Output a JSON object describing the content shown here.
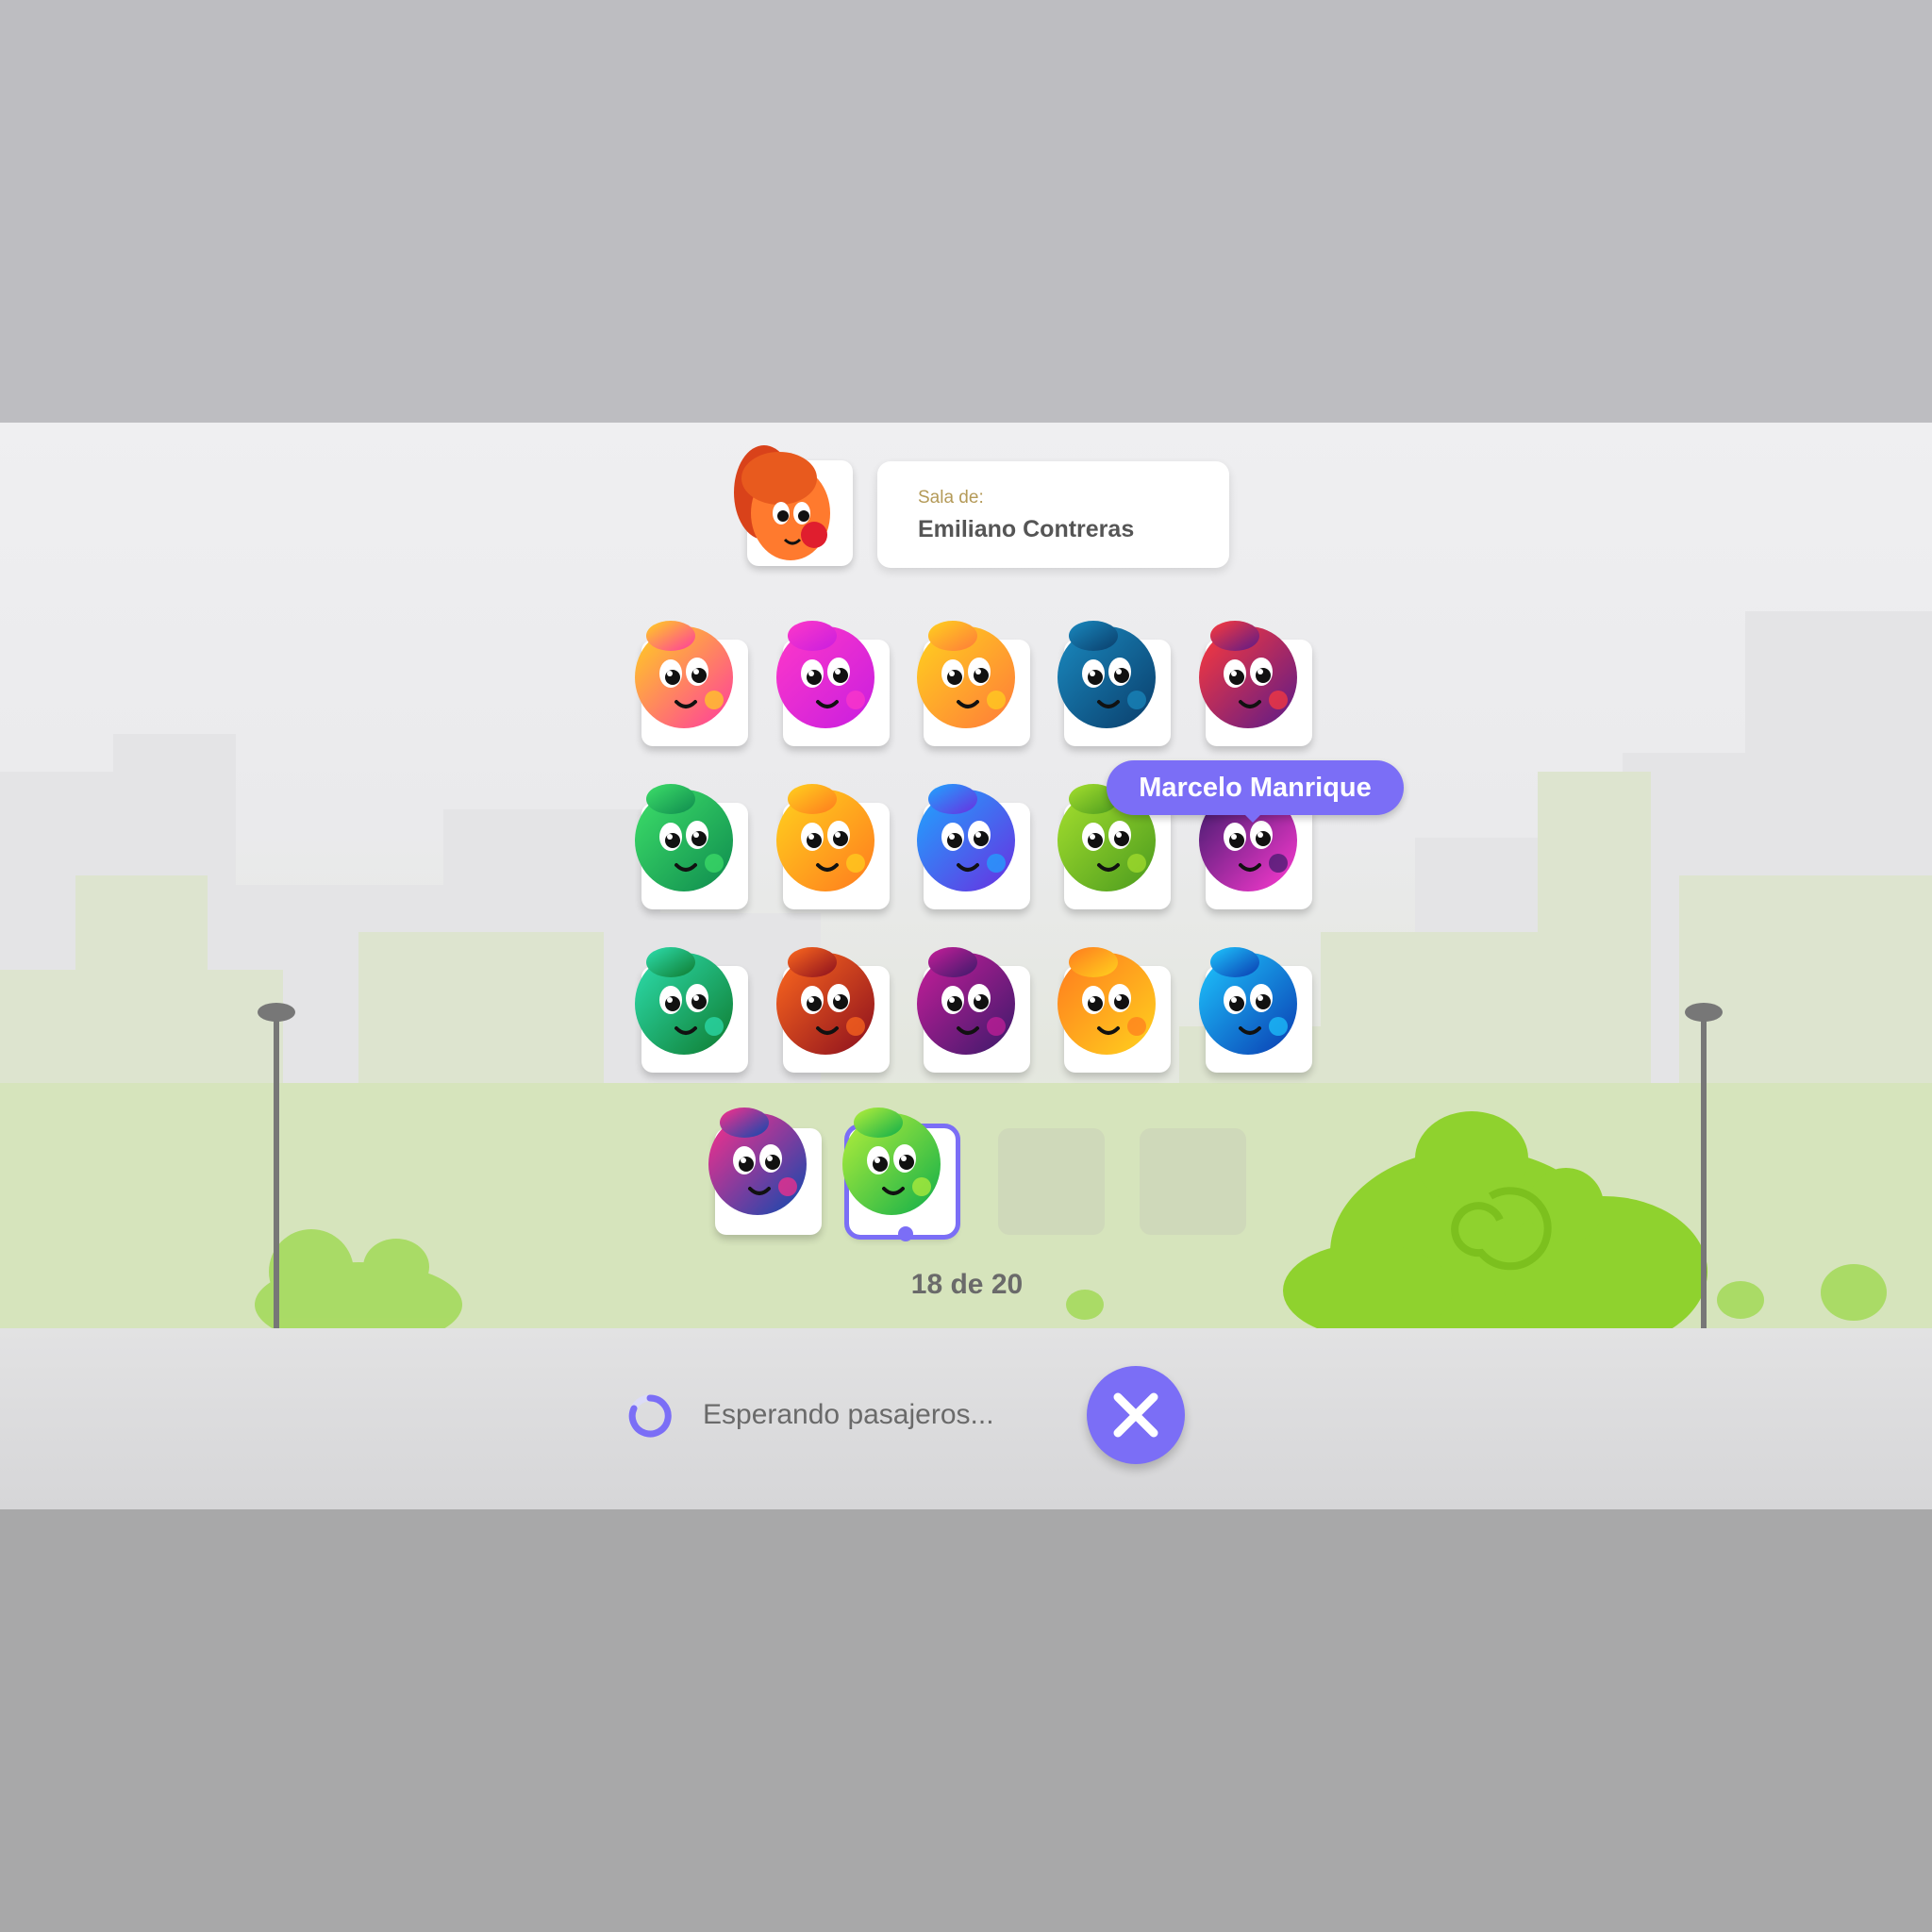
{
  "room": {
    "label": "Sala de:",
    "owner": "Emiliano Contreras"
  },
  "host": {
    "avatar_colors": [
      "#e0481c",
      "#ff8a3a"
    ]
  },
  "tooltip": {
    "name": "Marcelo Manrique"
  },
  "counter": {
    "text": "18 de 20",
    "current": 18,
    "capacity": 20
  },
  "status": {
    "text": "Esperando pasajeros..."
  },
  "cancel_button": {
    "icon": "close-icon"
  },
  "colors": {
    "accent": "#7b6ef6",
    "bush": "#8fd22e"
  },
  "players": [
    {
      "slot": 1,
      "colors": [
        "#ffd21e",
        "#ff3aa0"
      ]
    },
    {
      "slot": 2,
      "colors": [
        "#ff38c8",
        "#c81ee0"
      ]
    },
    {
      "slot": 3,
      "colors": [
        "#ffd21e",
        "#ff7a3a"
      ]
    },
    {
      "slot": 4,
      "colors": [
        "#1a8ac0",
        "#0a3d6a"
      ]
    },
    {
      "slot": 5,
      "colors": [
        "#ff3a3a",
        "#5a1a8a"
      ]
    },
    {
      "slot": 6,
      "colors": [
        "#3ee06a",
        "#0e8a4e"
      ]
    },
    {
      "slot": 7,
      "colors": [
        "#ffd21e",
        "#ff7a1e"
      ]
    },
    {
      "slot": 8,
      "colors": [
        "#1ea6ff",
        "#6a2ee0"
      ]
    },
    {
      "slot": 9,
      "colors": [
        "#a6e02e",
        "#4a9a1e"
      ]
    },
    {
      "slot": 10,
      "colors": [
        "#3a1a6a",
        "#ff3ad2"
      ]
    },
    {
      "slot": 11,
      "colors": [
        "#2ee0b0",
        "#0e7a2e"
      ]
    },
    {
      "slot": 12,
      "colors": [
        "#ff6a1e",
        "#8a0e1e"
      ]
    },
    {
      "slot": 13,
      "colors": [
        "#c81e9a",
        "#3a1a6a"
      ]
    },
    {
      "slot": 14,
      "colors": [
        "#ff7a1e",
        "#ffd21e"
      ]
    },
    {
      "slot": 15,
      "colors": [
        "#1ec8ff",
        "#0a3ab0"
      ]
    },
    {
      "slot": 16,
      "colors": [
        "#ff2e8a",
        "#0a4ab0"
      ]
    },
    {
      "slot": 17,
      "colors": [
        "#b8f03a",
        "#0eae4a"
      ]
    }
  ]
}
